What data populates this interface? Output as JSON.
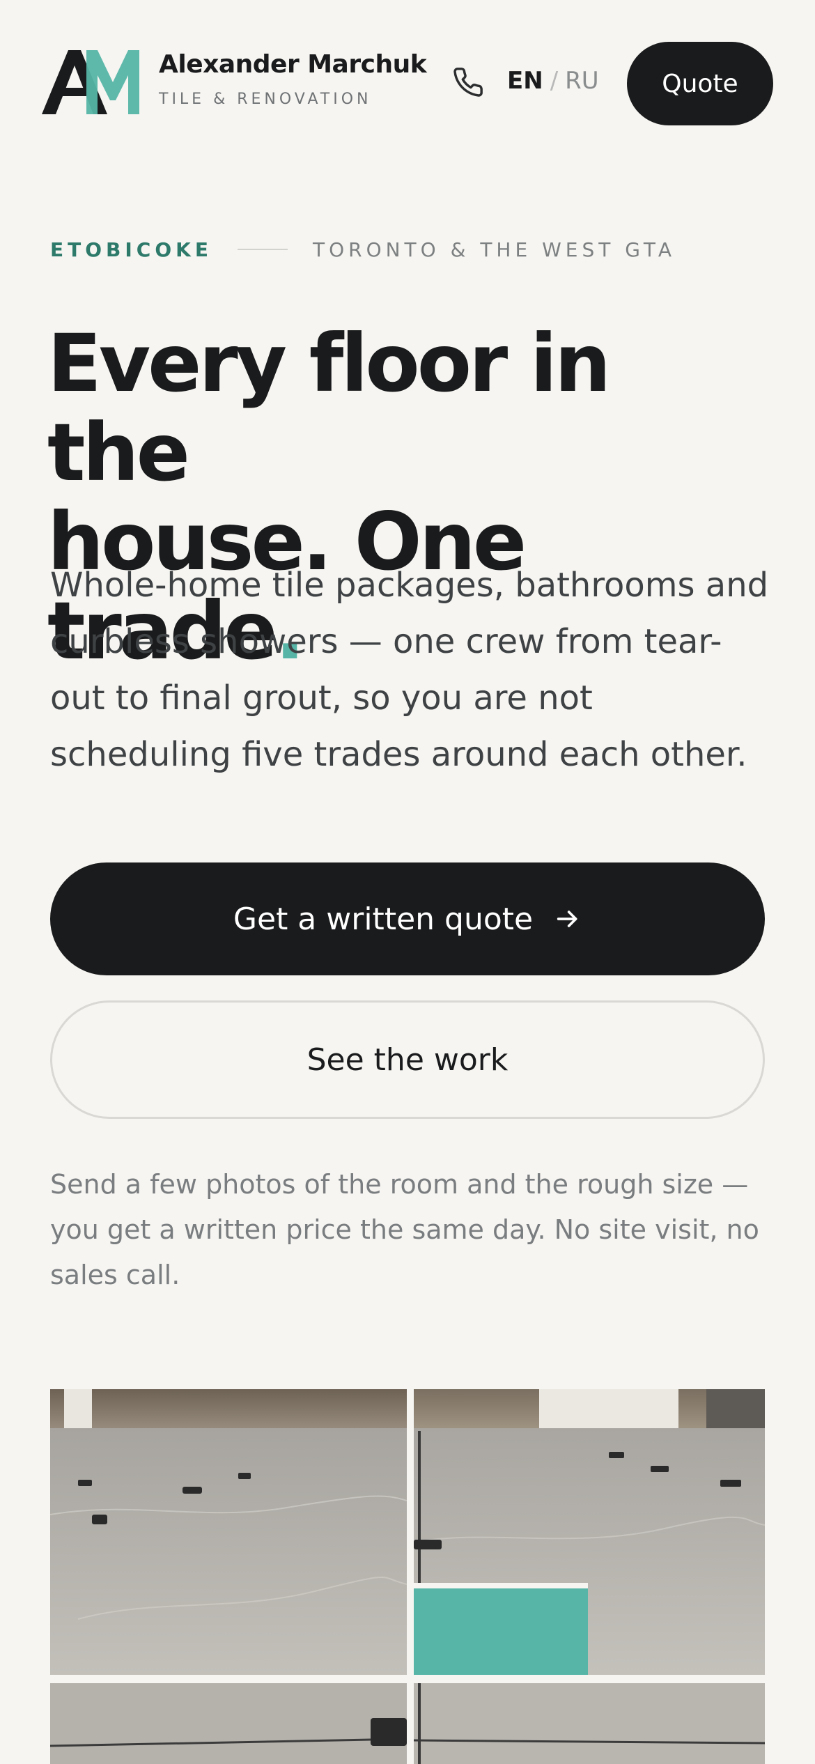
{
  "header": {
    "brand_name": "Alexander Marchuk",
    "brand_tagline": "TILE & RENOVATION",
    "lang_en": "EN",
    "lang_separator": "/",
    "lang_ru": "RU",
    "quote_label": "Quote"
  },
  "hero": {
    "location_primary": "ETOBICOKE",
    "location_secondary": "TORONTO & THE WEST GTA",
    "headline_line1": "Every floor in the",
    "headline_line2": "house. One trade",
    "headline_dot": ".",
    "lede": "Whole-home tile packages, bathrooms and curbless showers — one crew from tear-out to final grout, so you are not scheduling five trades around each other.",
    "cta_primary": "Get a written quote",
    "cta_secondary": "See the work",
    "note": "Send a few photos of the room and the rough size — you get a written price the same day. No site visit, no sales call."
  },
  "colors": {
    "accent": "#56b5a6",
    "ink": "#1a1b1c",
    "background": "#f6f5f2"
  },
  "icons": [
    "logo-mark",
    "phone-icon",
    "arrow-right-icon"
  ]
}
